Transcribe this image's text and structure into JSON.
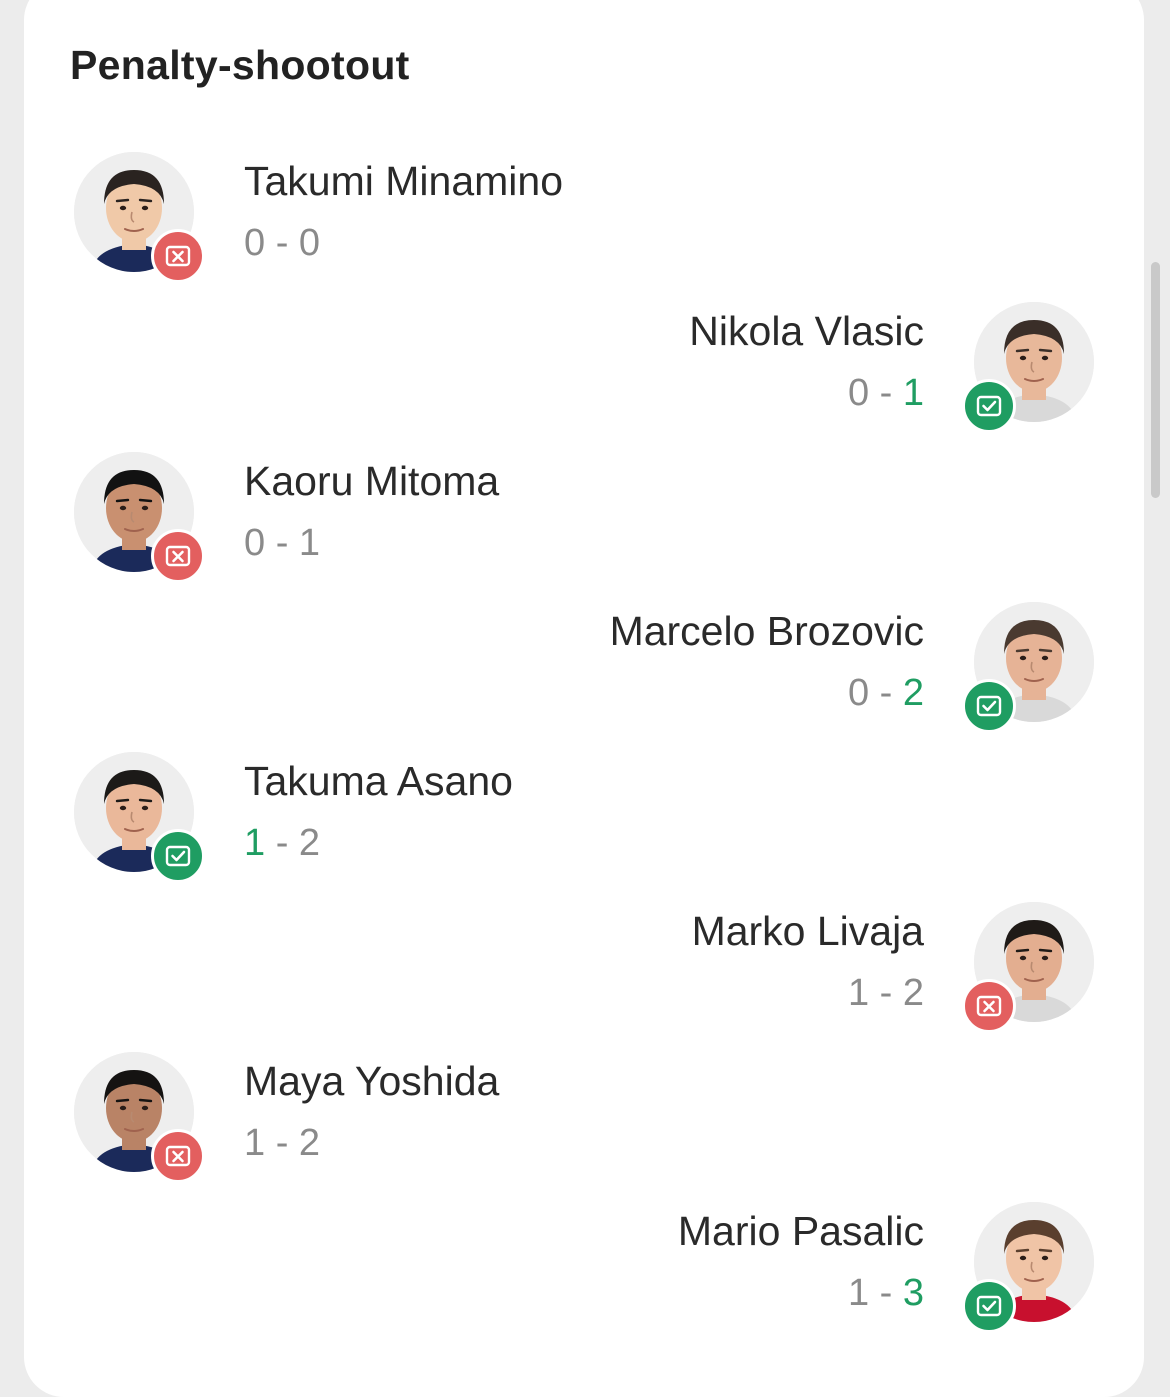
{
  "title": "Penalty-shootout",
  "kicks": [
    {
      "side": "left",
      "player": "Takumi Minamino",
      "home": "0",
      "sep": "-",
      "away": "0",
      "result": "miss",
      "result_icon": "goal-missed-icon",
      "skin": "#f0c9a8",
      "hair": "#2a2320",
      "shirt": "#1b2a5a"
    },
    {
      "side": "right",
      "player": "Nikola Vlasic",
      "home": "0",
      "sep": "-",
      "away": "1",
      "result": "goal",
      "result_icon": "goal-scored-icon",
      "skin": "#e8b89a",
      "hair": "#3a2e28",
      "shirt": "#d9d9d9"
    },
    {
      "side": "left",
      "player": "Kaoru Mitoma",
      "home": "0",
      "sep": "-",
      "away": "1",
      "result": "miss",
      "result_icon": "goal-missed-icon",
      "skin": "#c99070",
      "hair": "#121212",
      "shirt": "#1b2a5a"
    },
    {
      "side": "right",
      "player": "Marcelo Brozovic",
      "home": "0",
      "sep": "-",
      "away": "2",
      "result": "goal",
      "result_icon": "goal-scored-icon",
      "skin": "#e6b396",
      "hair": "#4a3a30",
      "shirt": "#d9d9d9"
    },
    {
      "side": "left",
      "player": "Takuma Asano",
      "home": "1",
      "sep": "-",
      "away": "2",
      "result": "goal",
      "result_icon": "goal-scored-icon",
      "skin": "#eab89a",
      "hair": "#1c1a18",
      "shirt": "#1b2a5a"
    },
    {
      "side": "right",
      "player": "Marko Livaja",
      "home": "1",
      "sep": "-",
      "away": "2",
      "result": "miss",
      "result_icon": "goal-missed-icon",
      "skin": "#e3ae90",
      "hair": "#1f1a17",
      "shirt": "#d9d9d9"
    },
    {
      "side": "left",
      "player": "Maya Yoshida",
      "home": "1",
      "sep": "-",
      "away": "2",
      "result": "miss",
      "result_icon": "goal-missed-icon",
      "skin": "#b98366",
      "hair": "#151312",
      "shirt": "#1b2a5a"
    },
    {
      "side": "right",
      "player": "Mario Pasalic",
      "home": "1",
      "sep": "-",
      "away": "3",
      "result": "goal",
      "result_icon": "goal-scored-icon",
      "skin": "#f0c4a6",
      "hair": "#5a3f2e",
      "shirt": "#c8102e"
    }
  ]
}
